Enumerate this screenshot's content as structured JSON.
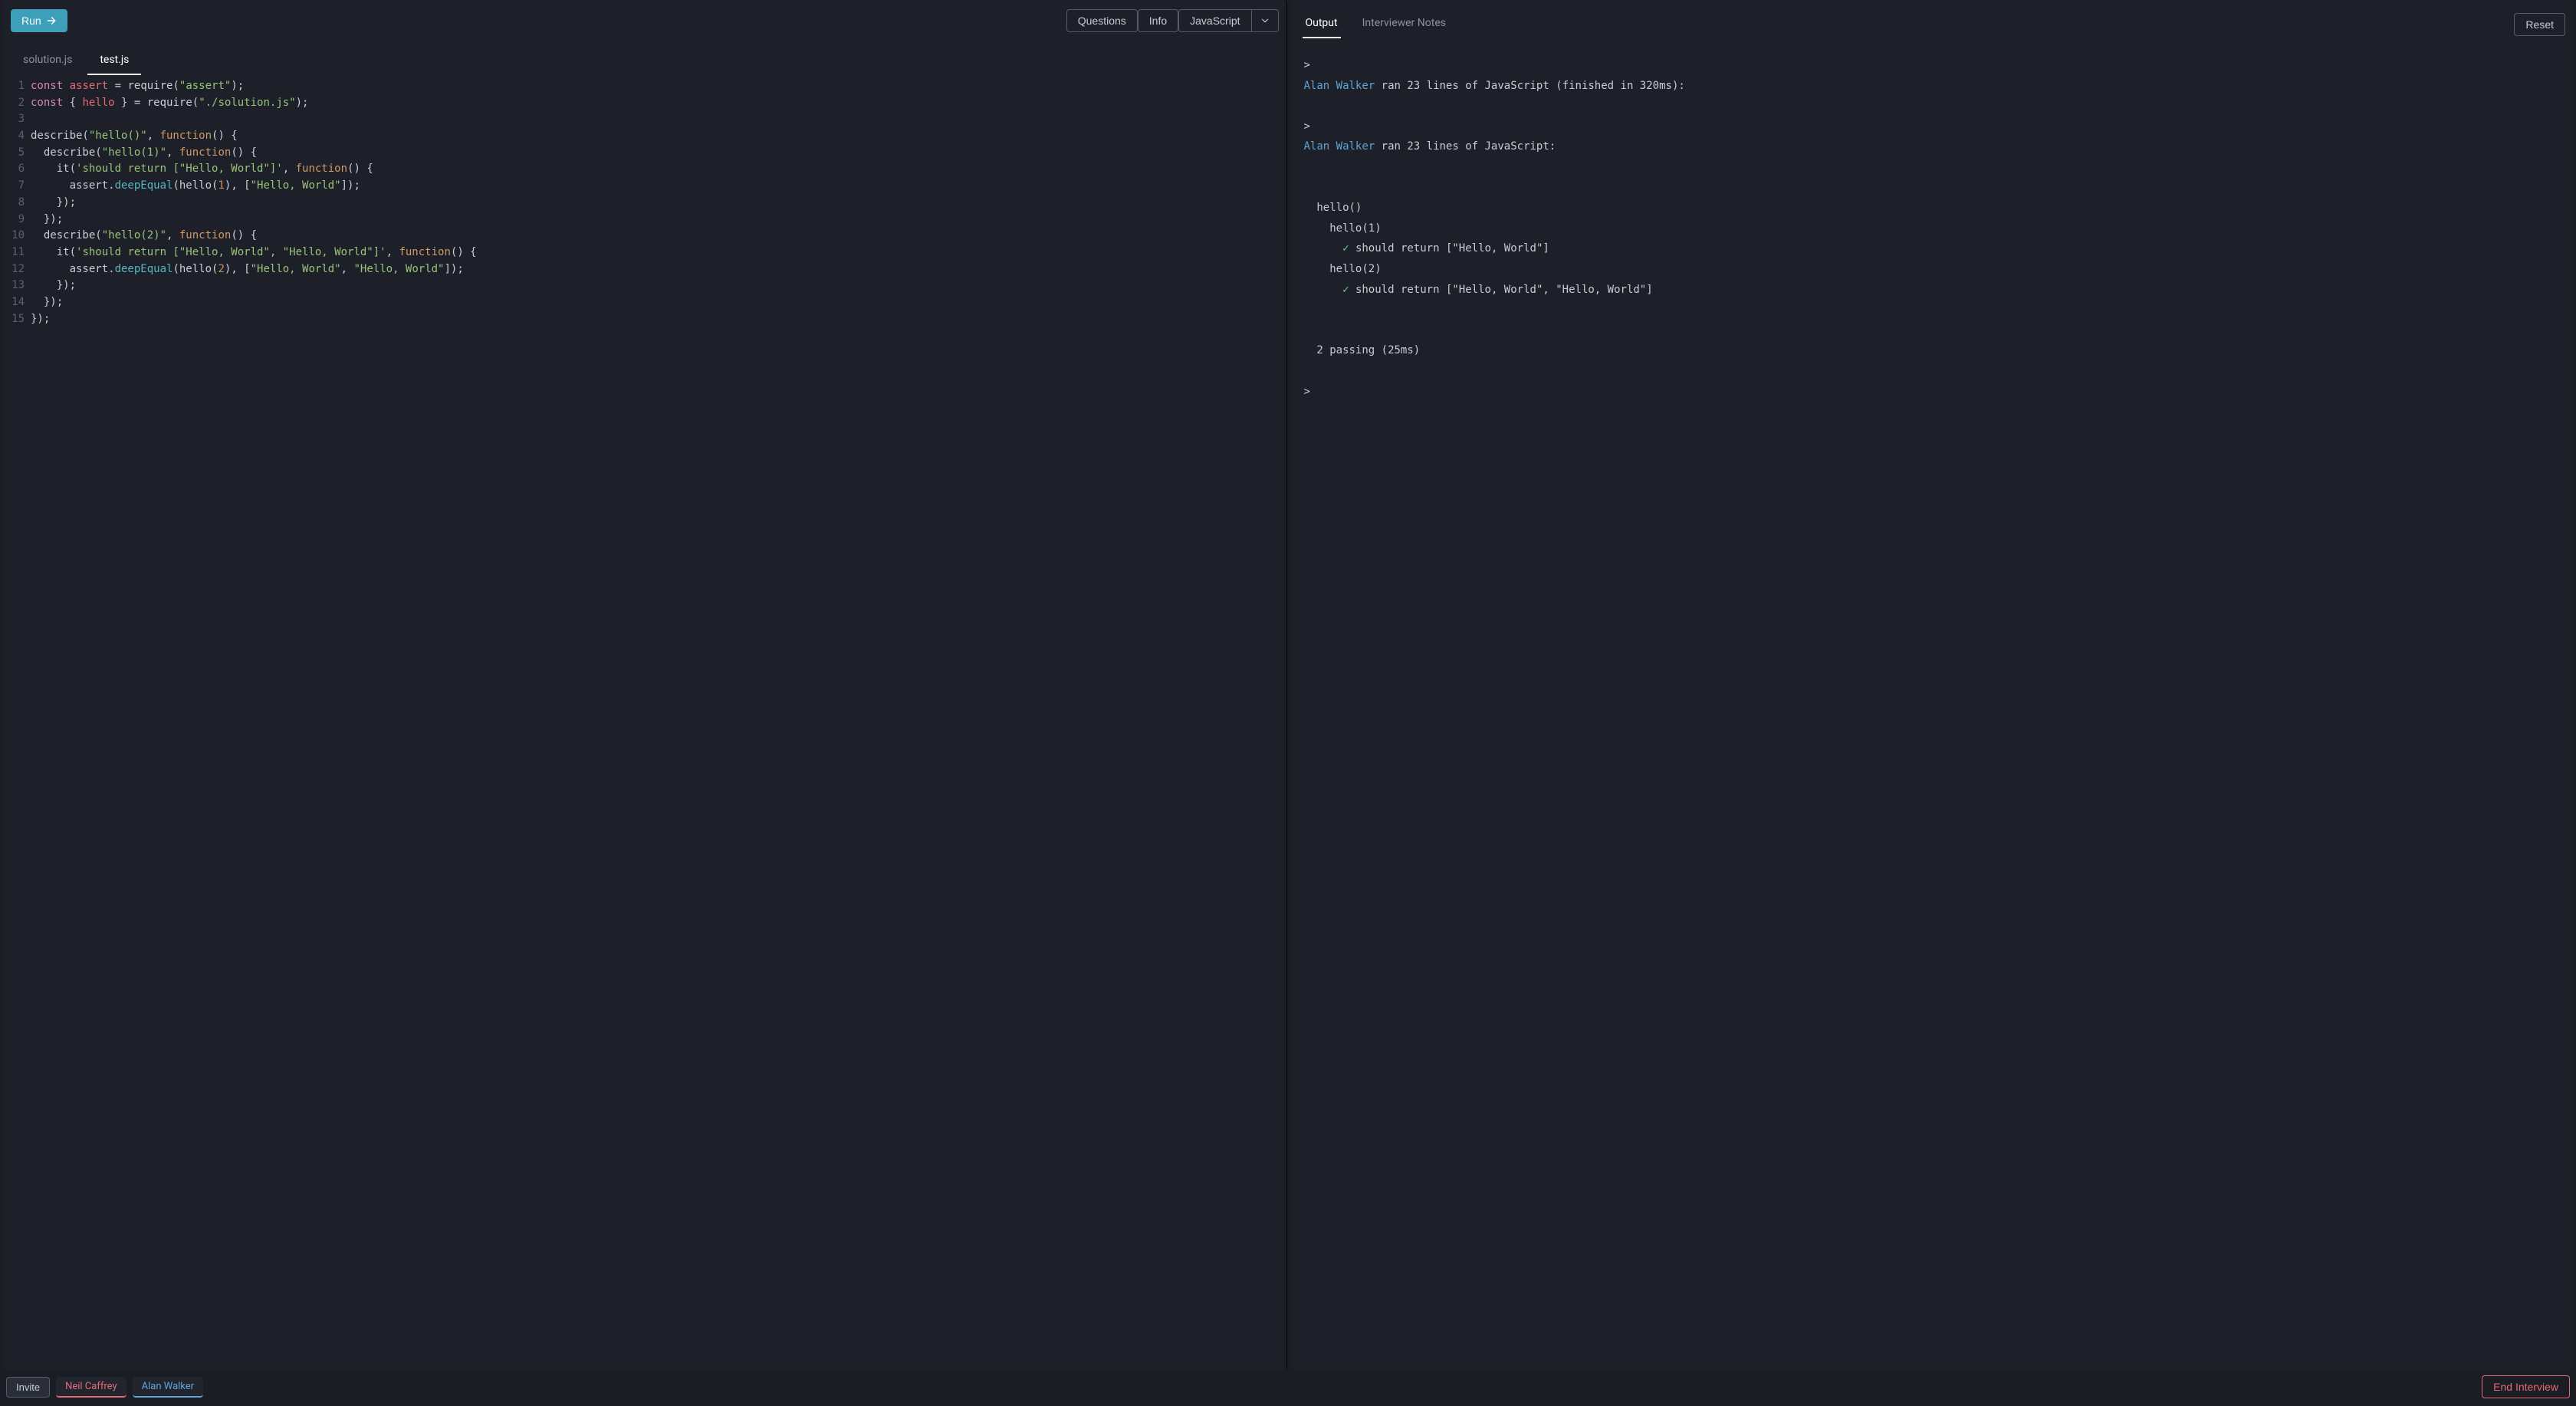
{
  "toolbar": {
    "run_label": "Run",
    "questions_label": "Questions",
    "info_label": "Info",
    "language_label": "JavaScript",
    "reset_label": "Reset"
  },
  "file_tabs": {
    "inactive": "solution.js",
    "active": "test.js"
  },
  "right_tabs": {
    "output": "Output",
    "notes": "Interviewer Notes"
  },
  "code_lines": [
    {
      "num": "1",
      "tokens": [
        [
          "tok-kw",
          "const"
        ],
        [
          "",
          " "
        ],
        [
          "tok-var",
          "assert"
        ],
        [
          "",
          " = require("
        ],
        [
          "tok-str",
          "\"assert\""
        ],
        [
          "",
          ");"
        ]
      ]
    },
    {
      "num": "2",
      "tokens": [
        [
          "tok-kw",
          "const"
        ],
        [
          "",
          " { "
        ],
        [
          "tok-var",
          "hello"
        ],
        [
          "",
          " } = require("
        ],
        [
          "tok-str",
          "\"./solution.js\""
        ],
        [
          "",
          ");"
        ]
      ]
    },
    {
      "num": "3",
      "tokens": [
        [
          "",
          ""
        ]
      ]
    },
    {
      "num": "4",
      "tokens": [
        [
          "",
          "describe("
        ],
        [
          "tok-str",
          "\"hello()\""
        ],
        [
          "",
          ", "
        ],
        [
          "tok-fn",
          "function"
        ],
        [
          "",
          "() {"
        ]
      ]
    },
    {
      "num": "5",
      "tokens": [
        [
          "",
          "  describe("
        ],
        [
          "tok-str",
          "\"hello(1)\""
        ],
        [
          "",
          ", "
        ],
        [
          "tok-fn",
          "function"
        ],
        [
          "",
          "() {"
        ]
      ]
    },
    {
      "num": "6",
      "tokens": [
        [
          "",
          "    it("
        ],
        [
          "tok-str",
          "'should return [\"Hello, World\"]'"
        ],
        [
          "",
          ", "
        ],
        [
          "tok-fn",
          "function"
        ],
        [
          "",
          "() {"
        ]
      ]
    },
    {
      "num": "7",
      "tokens": [
        [
          "",
          "      assert."
        ],
        [
          "tok-method",
          "deepEqual"
        ],
        [
          "",
          "(hello("
        ],
        [
          "tok-num",
          "1"
        ],
        [
          "",
          "), ["
        ],
        [
          "tok-str",
          "\"Hello, World\""
        ],
        [
          "",
          "]);"
        ]
      ]
    },
    {
      "num": "8",
      "tokens": [
        [
          "",
          "    });"
        ]
      ]
    },
    {
      "num": "9",
      "tokens": [
        [
          "",
          "  });"
        ]
      ]
    },
    {
      "num": "10",
      "tokens": [
        [
          "",
          "  describe("
        ],
        [
          "tok-str",
          "\"hello(2)\""
        ],
        [
          "",
          ", "
        ],
        [
          "tok-fn",
          "function"
        ],
        [
          "",
          "() {"
        ]
      ]
    },
    {
      "num": "11",
      "tokens": [
        [
          "",
          "    it("
        ],
        [
          "tok-str",
          "'should return [\"Hello, World\", \"Hello, World\"]'"
        ],
        [
          "",
          ", "
        ],
        [
          "tok-fn",
          "function"
        ],
        [
          "",
          "() {"
        ]
      ]
    },
    {
      "num": "12",
      "tokens": [
        [
          "",
          "      assert."
        ],
        [
          "tok-method",
          "deepEqual"
        ],
        [
          "",
          "(hello("
        ],
        [
          "tok-num",
          "2"
        ],
        [
          "",
          "), ["
        ],
        [
          "tok-str",
          "\"Hello, World\""
        ],
        [
          "",
          ", "
        ],
        [
          "tok-str",
          "\"Hello, World\""
        ],
        [
          "",
          "]);"
        ]
      ]
    },
    {
      "num": "13",
      "tokens": [
        [
          "",
          "    });"
        ]
      ]
    },
    {
      "num": "14",
      "tokens": [
        [
          "",
          "  });"
        ]
      ]
    },
    {
      "num": "15",
      "tokens": [
        [
          "",
          "});"
        ]
      ]
    }
  ],
  "output": {
    "prompt": ">",
    "runner": "Alan Walker",
    "ran_line_1_rest": " ran 23 lines of JavaScript (finished in 320ms):",
    "ran_line_2_rest": " ran 23 lines of JavaScript:",
    "suite_root": "  hello()",
    "suite_1": "    hello(1)",
    "test_1": " should return [\"Hello, World\"]",
    "suite_2": "    hello(2)",
    "test_2": " should return [\"Hello, World\", \"Hello, World\"]",
    "summary": "  2 passing (25ms)"
  },
  "bottom": {
    "invite": "Invite",
    "user1": "Neil Caffrey",
    "user2": "Alan Walker",
    "end": "End Interview"
  }
}
